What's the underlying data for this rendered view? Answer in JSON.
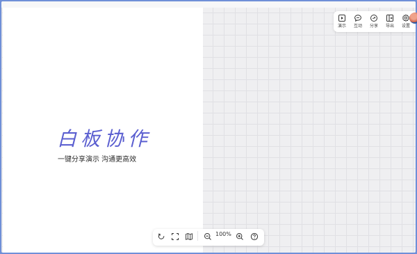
{
  "hero": {
    "title": "白板协作",
    "subtitle": "一键分享演示 沟通更高效"
  },
  "top_toolbar": {
    "items": [
      {
        "label": "演示",
        "icon": "present-icon"
      },
      {
        "label": "互动",
        "icon": "chat-icon"
      },
      {
        "label": "分享",
        "icon": "share-icon"
      },
      {
        "label": "导出",
        "icon": "export-icon"
      },
      {
        "label": "设置",
        "icon": "gear-icon"
      }
    ]
  },
  "bottom_toolbar": {
    "zoom": "100%",
    "icons": [
      "undo-icon",
      "fit-screen-icon",
      "map-icon",
      "zoom-out-icon",
      "zoom-in-icon",
      "help-icon"
    ]
  },
  "colors": {
    "accent": "#5b5fd0",
    "canvas": "#efeff1",
    "frame_border": "#6f8fd8"
  }
}
